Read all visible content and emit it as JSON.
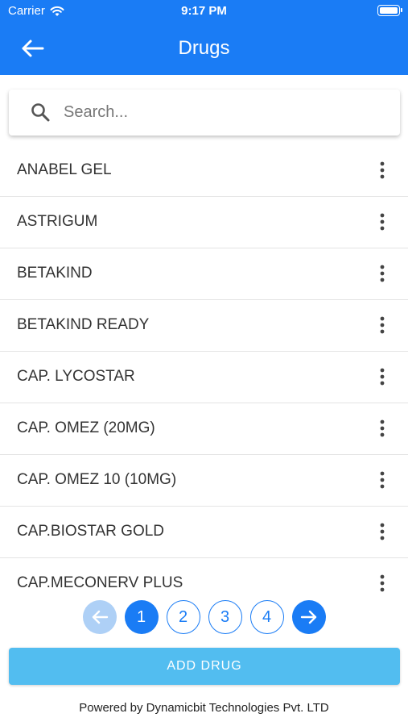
{
  "status_bar": {
    "carrier": "Carrier",
    "time": "9:17 PM"
  },
  "nav": {
    "title": "Drugs"
  },
  "search": {
    "placeholder": "Search...",
    "value": ""
  },
  "drugs": [
    "ANABEL GEL",
    "ASTRIGUM",
    "BETAKIND",
    "BETAKIND READY",
    "CAP. LYCOSTAR",
    "CAP. OMEZ (20MG)",
    "CAP. OMEZ 10 (10MG)",
    "CAP.BIOSTAR GOLD",
    "CAP.MECONERV PLUS"
  ],
  "pagination": {
    "pages": [
      "1",
      "2",
      "3",
      "4"
    ],
    "current_page": "1"
  },
  "actions": {
    "add_label": "ADD DRUG"
  },
  "footer": {
    "text": "Powered by Dynamicbit Technologies Pvt. LTD"
  },
  "colors": {
    "primary": "#1a7cf5",
    "add_button": "#52bdf0",
    "disabled": "#aed0f6"
  },
  "icons": {
    "back": "arrow-left-icon",
    "search": "search-icon",
    "more": "more-vertical-icon",
    "prev": "arrow-left-icon",
    "next": "arrow-right-icon",
    "wifi": "wifi-icon",
    "battery": "battery-icon"
  }
}
